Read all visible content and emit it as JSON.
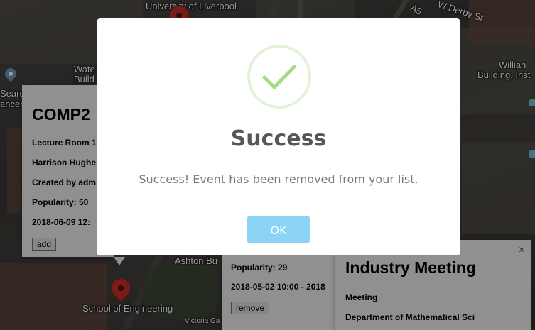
{
  "map": {
    "labels": {
      "university": "University of Liverpool",
      "derby_st": "W Derby St",
      "a5": "A5",
      "waterhouse": "Wate",
      "waterhouse2": "Build",
      "william": "Willian",
      "building_inst": "Building, Inst",
      "search": "Searc",
      "cancer": "ancer",
      "ashton": "Ashton Bu",
      "school_eng": "School of Engineering",
      "victoria": "Victoria Ga"
    }
  },
  "info_window_left": {
    "title": "COMP2",
    "room": "Lecture Room 1",
    "speaker": "Harrison Hughe",
    "created_by": "Created by adm",
    "popularity": "Popularity: 50",
    "datetime": "2018-06-09 12:",
    "add_label": "add"
  },
  "info_window_mid": {
    "popularity": "Popularity: 29",
    "datetime": "2018-05-02 10:00 - 2018",
    "remove_label": "remove"
  },
  "info_window_right": {
    "title": "Industry Meeting",
    "type": "Meeting",
    "department": "Department of Mathematical Sci",
    "close_symbol": "×"
  },
  "modal": {
    "title": "Success",
    "message": "Success! Event has been removed from your list.",
    "ok_label": "OK",
    "accent_color": "#8cd4f5",
    "check_color": "#a5dc86"
  }
}
